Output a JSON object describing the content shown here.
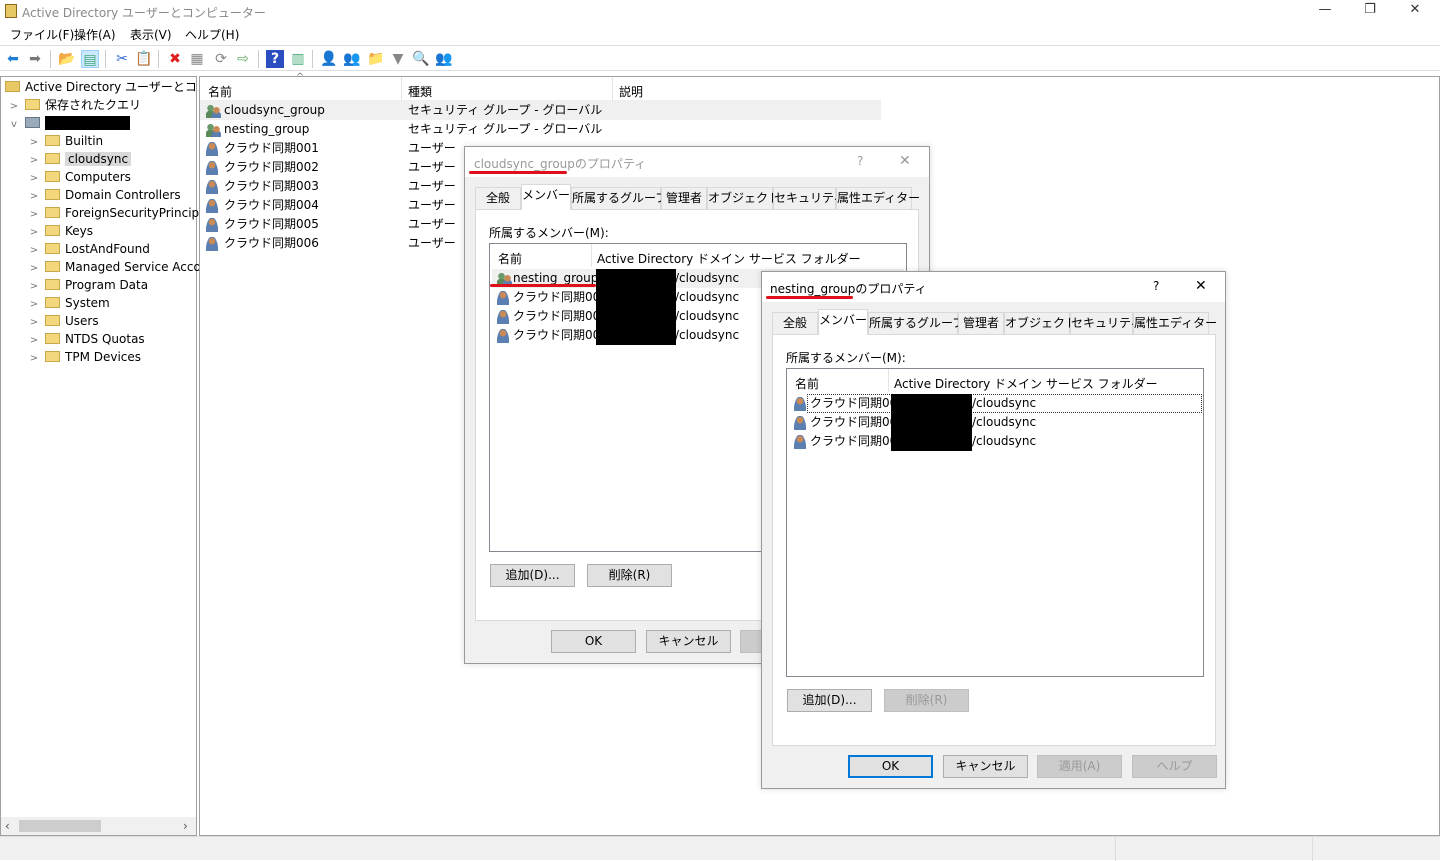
{
  "window": {
    "title": "Active Directory ユーザーとコンピューター",
    "minimize": "—",
    "restore": "❐",
    "close": "✕"
  },
  "menu": [
    "ファイル(F)",
    "操作(A)",
    "表示(V)",
    "ヘルプ(H)"
  ],
  "toolbar": [
    {
      "icon": "back-arrow-icon",
      "g": "⬅",
      "c": "#1e7fd6"
    },
    {
      "icon": "forward-arrow-icon",
      "g": "➡",
      "c": "#777"
    },
    {
      "icon": "up-folder-icon",
      "g": "📂",
      "c": "#c9a84a"
    },
    {
      "icon": "show-hide-console-tree-icon",
      "g": "▤",
      "c": "#4a7"
    },
    {
      "icon": "cut-icon",
      "g": "✂",
      "c": "#3366cc"
    },
    {
      "icon": "paste-icon",
      "g": "📋",
      "c": "#333"
    },
    {
      "icon": "delete-icon",
      "g": "✖",
      "c": "#e02020"
    },
    {
      "icon": "properties-icon",
      "g": "▦",
      "c": "#888"
    },
    {
      "icon": "refresh-icon",
      "g": "⟳",
      "c": "#888"
    },
    {
      "icon": "export-list-icon",
      "g": "⇨",
      "c": "#6a6"
    },
    {
      "icon": "help-icon",
      "g": "?",
      "c": "#fff"
    },
    {
      "icon": "action-pane-icon",
      "g": "▥",
      "c": "#4a7"
    },
    {
      "icon": "new-user-icon",
      "g": "👤",
      "c": "#5a7fb0"
    },
    {
      "icon": "new-group-icon",
      "g": "👥",
      "c": "#6a9a6a"
    },
    {
      "icon": "new-ou-icon",
      "g": "📁",
      "c": "#c9a84a"
    },
    {
      "icon": "filter-icon",
      "g": "▼",
      "c": "#888"
    },
    {
      "icon": "find-icon",
      "g": "🔍",
      "c": "#a88"
    },
    {
      "icon": "add-to-group-icon",
      "g": "👥",
      "c": "#3a7"
    }
  ],
  "tree": {
    "root": "Active Directory ユーザーとコンピュー",
    "saved_queries": "保存されたクエリ",
    "domain": "",
    "items": [
      "Builtin",
      "cloudsync",
      "Computers",
      "Domain Controllers",
      "ForeignSecurityPrincipals",
      "Keys",
      "LostAndFound",
      "Managed Service Accounts",
      "Program Data",
      "System",
      "Users",
      "NTDS Quotas",
      "TPM Devices"
    ],
    "selected": "cloudsync"
  },
  "list": {
    "columns": [
      "名前",
      "種類",
      "説明"
    ],
    "rows": [
      {
        "name": "cloudsync_group",
        "type": "セキュリティ グループ - グローバル",
        "icon": "group"
      },
      {
        "name": "nesting_group",
        "type": "セキュリティ グループ - グローバル",
        "icon": "group"
      },
      {
        "name": "クラウド同期001",
        "type": "ユーザー",
        "icon": "user"
      },
      {
        "name": "クラウド同期002",
        "type": "ユーザー",
        "icon": "user"
      },
      {
        "name": "クラウド同期003",
        "type": "ユーザー",
        "icon": "user"
      },
      {
        "name": "クラウド同期004",
        "type": "ユーザー",
        "icon": "user"
      },
      {
        "name": "クラウド同期005",
        "type": "ユーザー",
        "icon": "user"
      },
      {
        "name": "クラウド同期006",
        "type": "ユーザー",
        "icon": "user"
      }
    ]
  },
  "tabs": [
    "全般",
    "メンバー",
    "所属するグループ",
    "管理者",
    "オブジェクト",
    "セキュリティ",
    "属性エディター"
  ],
  "dialog1": {
    "title": "cloudsync_groupのプロパティ",
    "help": "?",
    "close": "✕",
    "members_label": "所属するメンバー(M):",
    "columns": [
      "名前",
      "Active Directory ドメイン サービス フォルダー"
    ],
    "members": [
      {
        "name": "nesting_group",
        "folder": "/cloudsync",
        "icon": "group"
      },
      {
        "name": "クラウド同期001",
        "folder": "/cloudsync",
        "icon": "user"
      },
      {
        "name": "クラウド同期002",
        "folder": "/cloudsync",
        "icon": "user"
      },
      {
        "name": "クラウド同期003",
        "folder": "/cloudsync",
        "icon": "user"
      }
    ],
    "add": "追加(D)...",
    "remove": "削除(R)",
    "ok": "OK",
    "cancel": "キャンセル"
  },
  "dialog2": {
    "title": "nesting_groupのプロパティ",
    "help": "?",
    "close": "✕",
    "members_label": "所属するメンバー(M):",
    "columns": [
      "名前",
      "Active Directory ドメイン サービス フォルダー"
    ],
    "members": [
      {
        "name": "クラウド同期004",
        "folder": "/cloudsync",
        "icon": "user"
      },
      {
        "name": "クラウド同期005",
        "folder": "/cloudsync",
        "icon": "user"
      },
      {
        "name": "クラウド同期006",
        "folder": "/cloudsync",
        "icon": "user"
      }
    ],
    "add": "追加(D)...",
    "remove": "削除(R)",
    "ok": "OK",
    "cancel": "キャンセル",
    "apply": "適用(A)",
    "helpbtn": "ヘルプ"
  },
  "colors": {
    "annotation": "#e0101a",
    "selection": "#cce8ff",
    "focus": "#0078d7"
  }
}
